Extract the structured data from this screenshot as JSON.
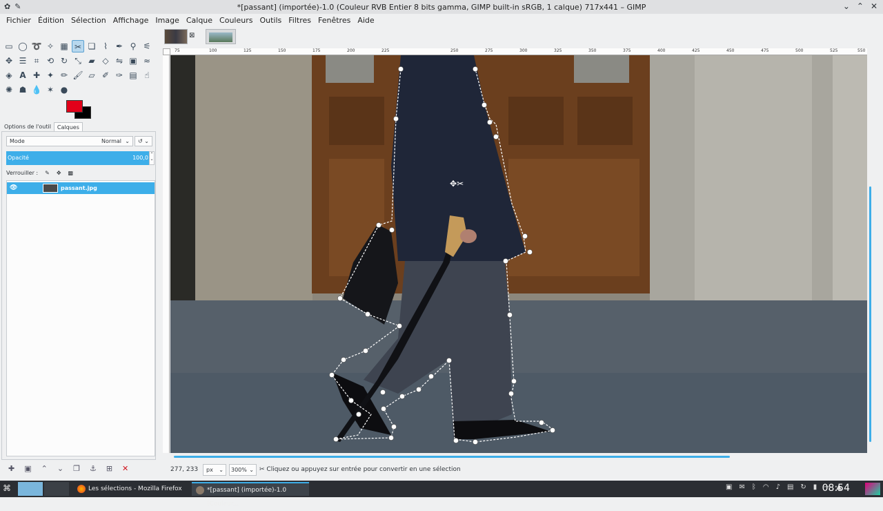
{
  "window": {
    "title": "*[passant] (importée)-1.0 (Couleur RVB Entier 8 bits gamma, GIMP built-in sRGB, 1 calque) 717x441 – GIMP"
  },
  "menubar": {
    "items": [
      "Fichier",
      "Édition",
      "Sélection",
      "Affichage",
      "Image",
      "Calque",
      "Couleurs",
      "Outils",
      "Filtres",
      "Fenêtres",
      "Aide"
    ]
  },
  "dock": {
    "tabs": [
      "Options de l'outil",
      "Calques"
    ],
    "mode_label": "Mode",
    "mode_value": "Normal",
    "opacity_label": "Opacité",
    "opacity_value": "100,0",
    "lock_label": "Verrouiller :",
    "layer_name": "passant.jpg"
  },
  "colors": {
    "foreground": "#e2001a",
    "background": "#000000",
    "accent": "#3daee9"
  },
  "ruler": {
    "top_ticks": [
      "75",
      "100",
      "125",
      "150",
      "175",
      "200",
      "225",
      "250",
      "275",
      "300",
      "325",
      "350",
      "375",
      "400",
      "425",
      "450",
      "475",
      "500",
      "525",
      "550"
    ]
  },
  "status": {
    "coords": "277, 233",
    "unit": "px",
    "zoom": "300%",
    "message": "Cliquez ou appuyez sur entrée pour convertir en une sélection"
  },
  "taskbar": {
    "tasks": [
      "Les sélections - Mozilla Firefox",
      "*[passant] (importée)-1.0 (Couleur..."
    ],
    "clock": "08:54"
  }
}
